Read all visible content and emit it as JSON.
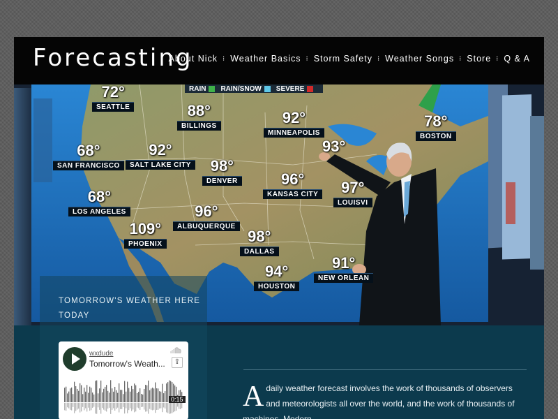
{
  "header": {
    "logo": "Forecasting",
    "nav": [
      {
        "label": "About Nick"
      },
      {
        "label": "Weather Basics"
      },
      {
        "label": "Storm Safety"
      },
      {
        "label": "Weather Songs"
      },
      {
        "label": "Store"
      },
      {
        "label": "Q & A"
      }
    ],
    "separator": "⁝"
  },
  "hero": {
    "legend": {
      "rain": "RAIN",
      "rain_snow": "RAIN/SNOW",
      "severe": "SEVERE"
    },
    "cities": [
      {
        "temp": "72°",
        "name": "SEATTLE"
      },
      {
        "temp": "88°",
        "name": "BILLINGS"
      },
      {
        "temp": "92°",
        "name": "MINNEAPOLIS"
      },
      {
        "temp": "78°",
        "name": "BOSTON"
      },
      {
        "temp": "68°",
        "name": "SAN FRANCISCO"
      },
      {
        "temp": "92°",
        "name": "SALT LAKE CITY"
      },
      {
        "temp": "98°",
        "name": "DENVER"
      },
      {
        "temp": "93°",
        "name": ""
      },
      {
        "temp": "96°",
        "name": "KANSAS CITY"
      },
      {
        "temp": "97°",
        "name": "LOUISVI"
      },
      {
        "temp": "68°",
        "name": "LOS ANGELES"
      },
      {
        "temp": "96°",
        "name": "ALBUQUERQUE"
      },
      {
        "temp": "109°",
        "name": "PHOENIX"
      },
      {
        "temp": "98°",
        "name": "DALLAS"
      },
      {
        "temp": "91°",
        "name": "NEW ORLEAN"
      },
      {
        "temp": "94°",
        "name": "HOUSTON"
      }
    ],
    "tagline": "Tomorrow's Weather Here Today"
  },
  "player": {
    "user": "wxdude",
    "title": "Tomorrow's Weath...",
    "time": "0:15"
  },
  "article": {
    "dropcap": "A",
    "text": "daily weather forecast involves the work of thousands of observers and meteorologists all over the world, and the work of thousands of  machines. Modern"
  },
  "colors": {
    "header_bg": "#050505",
    "site_bg": "#0c3a4d",
    "map_ocean": "#1f6fb8",
    "map_land": "#8a8a5a"
  }
}
